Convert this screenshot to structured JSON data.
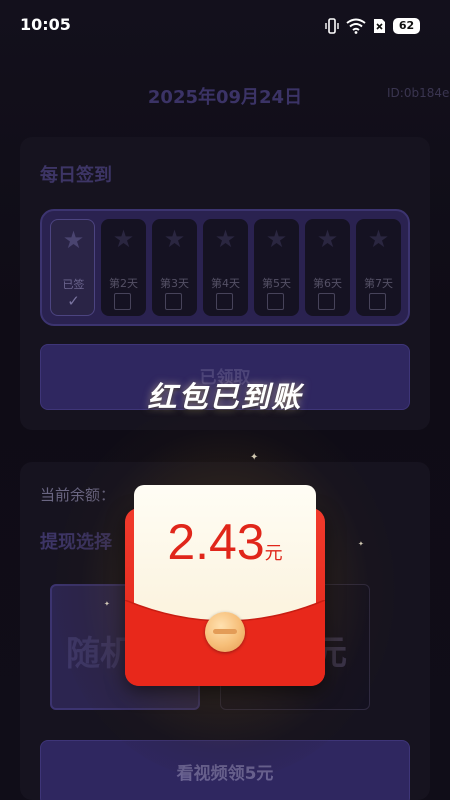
{
  "status_bar": {
    "time": "10:05",
    "battery": "62"
  },
  "header": {
    "date": "2025年09月24日",
    "id": "ID:0b184e"
  },
  "checkin": {
    "title": "每日签到",
    "days": [
      {
        "label": "已签",
        "checked": true
      },
      {
        "label": "第2天",
        "checked": false
      },
      {
        "label": "第3天",
        "checked": false
      },
      {
        "label": "第4天",
        "checked": false
      },
      {
        "label": "第5天",
        "checked": false
      },
      {
        "label": "第6天",
        "checked": false
      },
      {
        "label": "第7天",
        "checked": false
      }
    ],
    "button_label": "已领取"
  },
  "popup": {
    "headline": "红包已到账",
    "amount": "2.43",
    "unit": "元"
  },
  "wallet": {
    "balance_label": "当前余额：",
    "withdraw_title": "提现选择",
    "option_left_text": "随机",
    "option_right_text": "元",
    "video_button_label": "看视频领5元"
  },
  "colors": {
    "accent_purple": "#2f2760",
    "packet_red": "#e02418",
    "amount_red": "#e0261a"
  },
  "icons": {
    "star": "star-icon",
    "check": "checkmark-icon",
    "checkbox": "checkbox-icon"
  }
}
